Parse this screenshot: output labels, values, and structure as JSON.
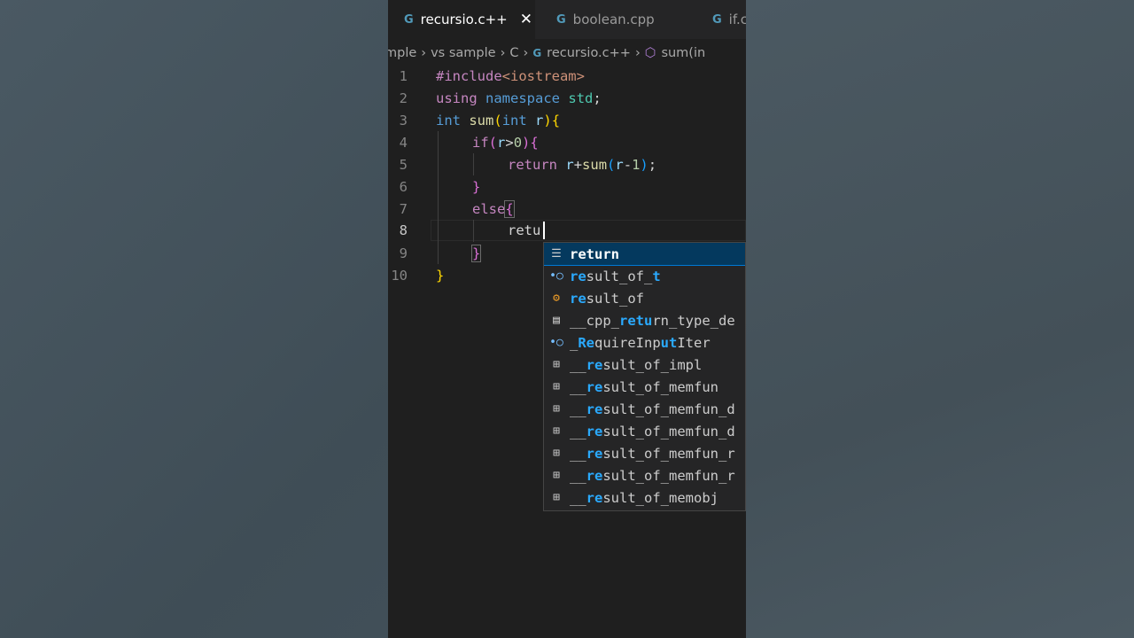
{
  "tabs": [
    {
      "label": "recursio.c++",
      "icon": "cpp-file-icon",
      "active": true
    },
    {
      "label": "boolean.cpp",
      "icon": "cpp-file-icon",
      "active": false
    },
    {
      "label": "if.c",
      "icon": "cpp-file-icon",
      "active": false
    }
  ],
  "breadcrumb": {
    "items": [
      "mple",
      "vs sample",
      "C",
      "recursio.c++",
      "sum(in"
    ]
  },
  "line_numbers": [
    "1",
    "2",
    "3",
    "4",
    "5",
    "6",
    "7",
    "8",
    "9",
    "10"
  ],
  "code": {
    "l1": {
      "pp": "#include",
      "hdr": "<iostream>"
    },
    "l2": {
      "kw1": "using",
      "kw2": "namespace",
      "ns": "std",
      "end": ";"
    },
    "l3": {
      "type": "int",
      "fn": "sum",
      "op": "(",
      "type2": "int",
      "param": "r",
      "cp": ")",
      "ob": "{"
    },
    "l4": {
      "kw": "if",
      "op": "(",
      "var": "r",
      "gt": ">",
      "num": "0",
      "cp": ")",
      "ob": "{"
    },
    "l5": {
      "kw": "return",
      "var": "r",
      "plus": "+",
      "fn": "sum",
      "op": "(",
      "var2": "r",
      "minus": "-",
      "num": "1",
      "cp": ")",
      "end": ";"
    },
    "l6": {
      "cb": "}"
    },
    "l7": {
      "kw": "else",
      "ob": "{"
    },
    "l8": {
      "typed": "retu"
    },
    "l9": {
      "cb": "}"
    },
    "l10": {
      "cb": "}"
    }
  },
  "suggestions": [
    {
      "icon": "keyword-icon",
      "pre": "",
      "hl": "return",
      "post": "",
      "selected": true
    },
    {
      "icon": "field-icon",
      "pre": "",
      "hl": "re",
      "post": "sult_of_",
      "hl2": "t",
      "post2": ""
    },
    {
      "icon": "class-icon",
      "pre": "",
      "hl": "re",
      "post": "sult_of",
      "hl2": "",
      "post2": ""
    },
    {
      "icon": "text-icon",
      "pre": "__cpp_",
      "hl": "retu",
      "post": "rn_type_de",
      "hl2": "",
      "post2": ""
    },
    {
      "icon": "field-icon",
      "pre": "_",
      "hl": "Re",
      "post": "quireInp",
      "hl2": "ut",
      "post2": "Iter"
    },
    {
      "icon": "struct-icon",
      "pre": "__",
      "hl": "re",
      "post": "sult_of_impl",
      "hl2": "",
      "post2": ""
    },
    {
      "icon": "struct-icon",
      "pre": "__",
      "hl": "re",
      "post": "sult_of_memfun",
      "hl2": "",
      "post2": ""
    },
    {
      "icon": "struct-icon",
      "pre": "__",
      "hl": "re",
      "post": "sult_of_memfun_d",
      "hl2": "",
      "post2": ""
    },
    {
      "icon": "struct-icon",
      "pre": "__",
      "hl": "re",
      "post": "sult_of_memfun_d",
      "hl2": "",
      "post2": ""
    },
    {
      "icon": "struct-icon",
      "pre": "__",
      "hl": "re",
      "post": "sult_of_memfun_r",
      "hl2": "",
      "post2": ""
    },
    {
      "icon": "struct-icon",
      "pre": "__",
      "hl": "re",
      "post": "sult_of_memfun_r",
      "hl2": "",
      "post2": ""
    },
    {
      "icon": "struct-icon",
      "pre": "__",
      "hl": "re",
      "post": "sult_of_memobj",
      "hl2": "",
      "post2": ""
    }
  ]
}
